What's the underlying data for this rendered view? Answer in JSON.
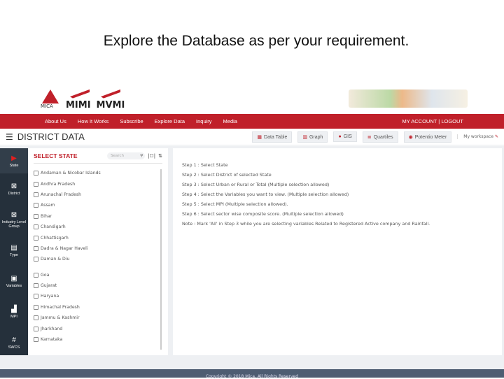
{
  "slide_title": "Explore the Database as per your requirement.",
  "logos": {
    "mica": "MICA",
    "mimi": "MIMI",
    "mvmi": "MVMI"
  },
  "nav": {
    "items": [
      "About Us",
      "How It Works",
      "Subscribe",
      "Explore Data",
      "Inquiry",
      "Media"
    ],
    "account": "MY ACCOUNT | LOGOUT"
  },
  "toolbar": {
    "title": "DISTRICT DATA",
    "buttons": [
      "Data Table",
      "Graph",
      "GIS",
      "Quartiles",
      "Potentio Meter"
    ],
    "workspace": "My workspace"
  },
  "sidebar": {
    "items": [
      "State",
      "District",
      "Industry Level Group",
      "Type",
      "Variables",
      "MPI",
      "SWCS"
    ]
  },
  "panel": {
    "heading": "SELECT STATE",
    "search_placeholder": "Search",
    "states": [
      "Andaman & Nicobar Islands",
      "Andhra Pradesh",
      "Arunachal Pradesh",
      "Assam",
      "Bihar",
      "Chandigarh",
      "Chhattisgarh",
      "Dadra & Nagar Haveli",
      "Daman & Diu",
      "Goa",
      "Gujarat",
      "Haryana",
      "Himachal Pradesh",
      "Jammu & Kashmir",
      "Jharkhand",
      "Karnataka"
    ]
  },
  "steps": [
    "Step 1 : Select State",
    "Step 2 : Select District of selected State",
    "Step 3 : Select Urban or Rural or Total (Multiple selection allowed)",
    "Step 4 : Select the Variables you want to view. (Multiple selection allowed)",
    "Step 5 : Select MPI (Multiple selection allowed).",
    "Step 6 : Select sector wise composite score. (Multiple selection allowed)",
    "Note : Mark 'All' in Step 3 while you are selecting variables Related to Registered Active company and Rainfall."
  ],
  "footer": "Copyright © 2018 Mica. All Rights Reserved"
}
